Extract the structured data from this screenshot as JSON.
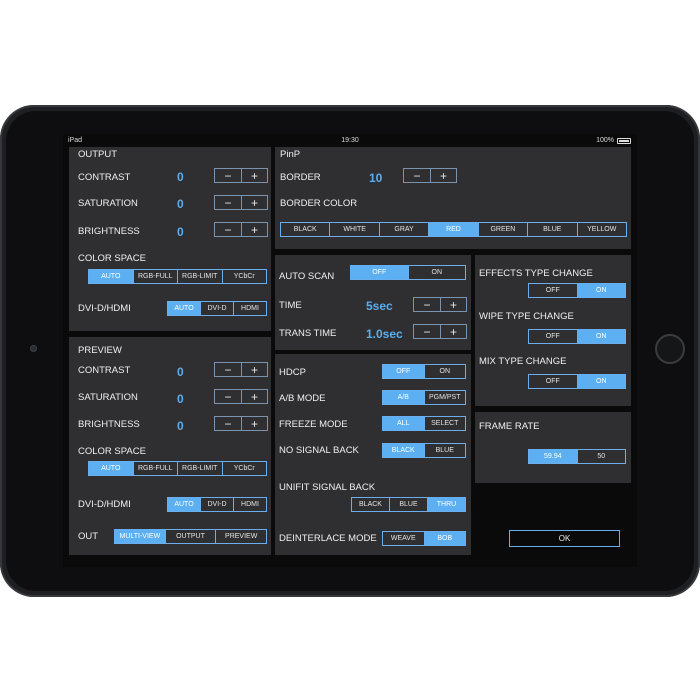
{
  "status": {
    "device": "iPad",
    "time": "19:30",
    "battery": "100%"
  },
  "output": {
    "title": "OUTPUT",
    "contrast": {
      "label": "CONTRAST",
      "value": "0"
    },
    "saturation": {
      "label": "SATURATION",
      "value": "0"
    },
    "brightness": {
      "label": "BRIGHTNESS",
      "value": "0"
    },
    "color_space": {
      "label": "COLOR SPACE",
      "options": [
        "AUTO",
        "RGB-FULL",
        "RGB-LIMIT",
        "YCbCr"
      ],
      "selected": "AUTO"
    },
    "dvi": {
      "label": "DVI-D/HDMI",
      "options": [
        "AUTO",
        "DVI-D",
        "HDMI"
      ],
      "selected": "AUTO"
    }
  },
  "preview": {
    "title": "PREVIEW",
    "contrast": {
      "label": "CONTRAST",
      "value": "0"
    },
    "saturation": {
      "label": "SATURATION",
      "value": "0"
    },
    "brightness": {
      "label": "BRIGHTNESS",
      "value": "0"
    },
    "color_space": {
      "label": "COLOR SPACE",
      "options": [
        "AUTO",
        "RGB-FULL",
        "RGB-LIMIT",
        "YCbCr"
      ],
      "selected": "AUTO"
    },
    "dvi": {
      "label": "DVI-D/HDMI",
      "options": [
        "AUTO",
        "DVI-D",
        "HDMI"
      ],
      "selected": "AUTO"
    },
    "out": {
      "label": "OUT",
      "options": [
        "MULTI-VIEW",
        "OUTPUT",
        "PREVIEW"
      ],
      "selected": "MULTI-VIEW"
    }
  },
  "pinp": {
    "title": "PinP",
    "border": {
      "label": "BORDER",
      "value": "10"
    },
    "border_color": {
      "label": "BORDER COLOR",
      "options": [
        "BLACK",
        "WHITE",
        "GRAY",
        "RED",
        "GREEN",
        "BLUE",
        "YELLOW"
      ],
      "selected": "RED"
    }
  },
  "scan": {
    "auto_scan": {
      "label": "AUTO SCAN",
      "options": [
        "OFF",
        "ON"
      ],
      "selected": "OFF"
    },
    "time": {
      "label": "TIME",
      "value": "5sec"
    },
    "trans_time": {
      "label": "TRANS TIME",
      "value": "1.0sec"
    }
  },
  "settings": {
    "hdcp": {
      "label": "HDCP",
      "options": [
        "OFF",
        "ON"
      ],
      "selected": "OFF"
    },
    "ab_mode": {
      "label": "A/B MODE",
      "options": [
        "A/B",
        "PGM/PST"
      ],
      "selected": "A/B"
    },
    "freeze_mode": {
      "label": "FREEZE MODE",
      "options": [
        "ALL",
        "SELECT"
      ],
      "selected": "ALL"
    },
    "no_signal_back": {
      "label": "NO SIGNAL BACK",
      "options": [
        "BLACK",
        "BLUE"
      ],
      "selected": "BLACK"
    },
    "unifit_signal_back": {
      "label": "UNIFIT  SIGNAL BACK",
      "options": [
        "BLACK",
        "BLUE",
        "THRU"
      ],
      "selected": "THRU"
    },
    "deinterlace_mode": {
      "label": "DEINTERLACE MODE",
      "options": [
        "WEAVE",
        "BOB"
      ],
      "selected": "BOB"
    }
  },
  "effects": {
    "effects_type_change": {
      "label": "EFFECTS TYPE CHANGE",
      "options": [
        "OFF",
        "ON"
      ],
      "selected": "ON"
    },
    "wipe_type_change": {
      "label": "WIPE TYPE CHANGE",
      "options": [
        "OFF",
        "ON"
      ],
      "selected": "ON"
    },
    "mix_type_change": {
      "label": "MIX TYPE CHANGE",
      "options": [
        "OFF",
        "ON"
      ],
      "selected": "ON"
    }
  },
  "frame_rate": {
    "label": "FRAME RATE",
    "options": [
      "59.94",
      "50"
    ],
    "selected": "59.94"
  },
  "ok_label": "OK",
  "stepper": {
    "minus": "−",
    "plus": "+"
  },
  "colors": {
    "accent": "#5cb0f2",
    "panel": "#2f2f31",
    "value_text": "#5aaef0",
    "background": "#0a0a0a"
  }
}
